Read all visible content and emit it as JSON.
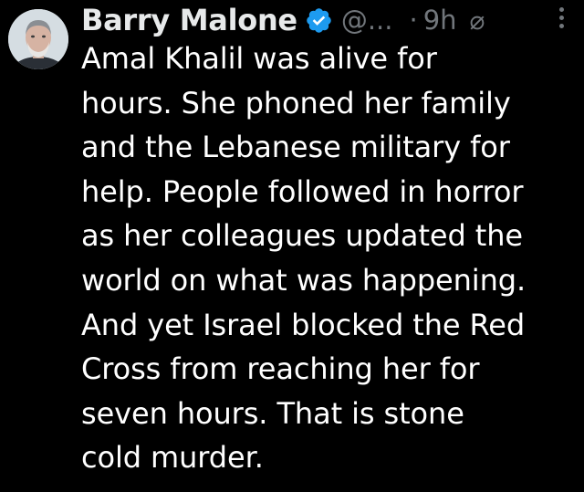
{
  "author": {
    "display_name": "Barry Malone",
    "handle": "@...",
    "verified_color": "#1d9bf0",
    "avatar_icon": "profile-photo"
  },
  "meta": {
    "separator": "·",
    "time": "9h",
    "edited_icon": "null-symbol-icon",
    "edited_glyph": "⌀"
  },
  "post": {
    "text": "Amal Khalil was alive for\nhours. She phoned her family\nand the Lebanese military for\nhelp. People followed in horror\nas her colleagues updated the\nworld on what was happening.\nAnd yet Israel blocked the Red\nCross from reaching her for\nseven hours. That is stone\ncold murder."
  },
  "colors": {
    "background": "#000000",
    "primary_text": "#ffffff",
    "secondary_text": "#71767b"
  }
}
